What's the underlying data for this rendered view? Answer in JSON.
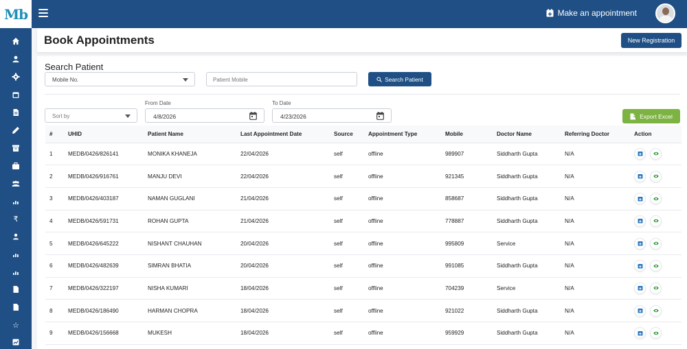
{
  "brand": {
    "logo": "Mb"
  },
  "topbar": {
    "make_appointment": "Make an appointment"
  },
  "header": {
    "title": "Book Appointments",
    "new_registration": "New Registration"
  },
  "search": {
    "title": "Search Patient",
    "type_select": "Mobile No.",
    "mobile_placeholder": "Patient Mobile",
    "search_button": "Search Patient"
  },
  "filters": {
    "sort_by": "Sort by",
    "from_label": "From Date",
    "from_value": "4/8/2026",
    "to_label": "To Date",
    "to_value": "4/23/2026",
    "export_button": "Export Excel"
  },
  "table": {
    "headers": [
      "#",
      "UHID",
      "Patient Name",
      "Last Appointment Date",
      "Source",
      "Appointment Type",
      "Mobile",
      "Doctor Name",
      "Referring Doctor",
      "Action"
    ],
    "rows": [
      {
        "num": "1",
        "uhid": "MEDB/0426/826141",
        "name": "MONIKA KHANEJA",
        "date": "22/04/2026",
        "source": "self",
        "type": "offline",
        "mobile": "989907",
        "doctor": "Siddharth Gupta",
        "ref": "N/A"
      },
      {
        "num": "2",
        "uhid": "MEDB/0426/916761",
        "name": "MANJU DEVI",
        "date": "22/04/2026",
        "source": "self",
        "type": "offline",
        "mobile": "921345",
        "doctor": "Siddharth Gupta",
        "ref": "N/A"
      },
      {
        "num": "3",
        "uhid": "MEDB/0426/403187",
        "name": "NAMAN GUGLANI",
        "date": "21/04/2026",
        "source": "self",
        "type": "offline",
        "mobile": "858687",
        "doctor": "Siddharth Gupta",
        "ref": "N/A"
      },
      {
        "num": "4",
        "uhid": "MEDB/0426/591731",
        "name": "ROHAN GUPTA",
        "date": "21/04/2026",
        "source": "self",
        "type": "offline",
        "mobile": "778887",
        "doctor": "Siddharth Gupta",
        "ref": "N/A"
      },
      {
        "num": "5",
        "uhid": "MEDB/0426/645222",
        "name": "NISHANT CHAUHAN",
        "date": "20/04/2026",
        "source": "self",
        "type": "offline",
        "mobile": "995809",
        "doctor": "Service",
        "ref": "N/A"
      },
      {
        "num": "6",
        "uhid": "MEDB/0426/482639",
        "name": "SIMRAN BHATIA",
        "date": "20/04/2026",
        "source": "self",
        "type": "offline",
        "mobile": "991085",
        "doctor": "Siddharth Gupta",
        "ref": "N/A"
      },
      {
        "num": "7",
        "uhid": "MEDB/0426/322197",
        "name": "NISHA KUMARI",
        "date": "18/04/2026",
        "source": "self",
        "type": "offline",
        "mobile": "704239",
        "doctor": "Service",
        "ref": "N/A"
      },
      {
        "num": "8",
        "uhid": "MEDB/0426/186490",
        "name": "HARMAN CHOPRA",
        "date": "18/04/2026",
        "source": "self",
        "type": "offline",
        "mobile": "921022",
        "doctor": "Siddharth Gupta",
        "ref": "N/A"
      },
      {
        "num": "9",
        "uhid": "MEDB/0426/156668",
        "name": "MUKESH",
        "date": "18/04/2026",
        "source": "self",
        "type": "offline",
        "mobile": "959929",
        "doctor": "Siddharth Gupta",
        "ref": "N/A"
      }
    ]
  },
  "sidebar": {
    "icons": [
      "home-icon",
      "user-icon",
      "gear-icon",
      "calendar-icon",
      "document-icon",
      "pen-icon",
      "archive-icon",
      "briefcase-icon",
      "group-icon",
      "chart-icon",
      "rupee-icon",
      "user-icon",
      "chart-icon",
      "chart-icon",
      "file-icon",
      "file-icon",
      "star-icon",
      "report-icon"
    ],
    "text_icons": {
      "rupee": "₹",
      "star": "☆"
    }
  },
  "colors": {
    "primary": "#1f4f85",
    "excel": "#7cb342",
    "view": "#2e9a3a",
    "calendar": "#2b78c2"
  }
}
